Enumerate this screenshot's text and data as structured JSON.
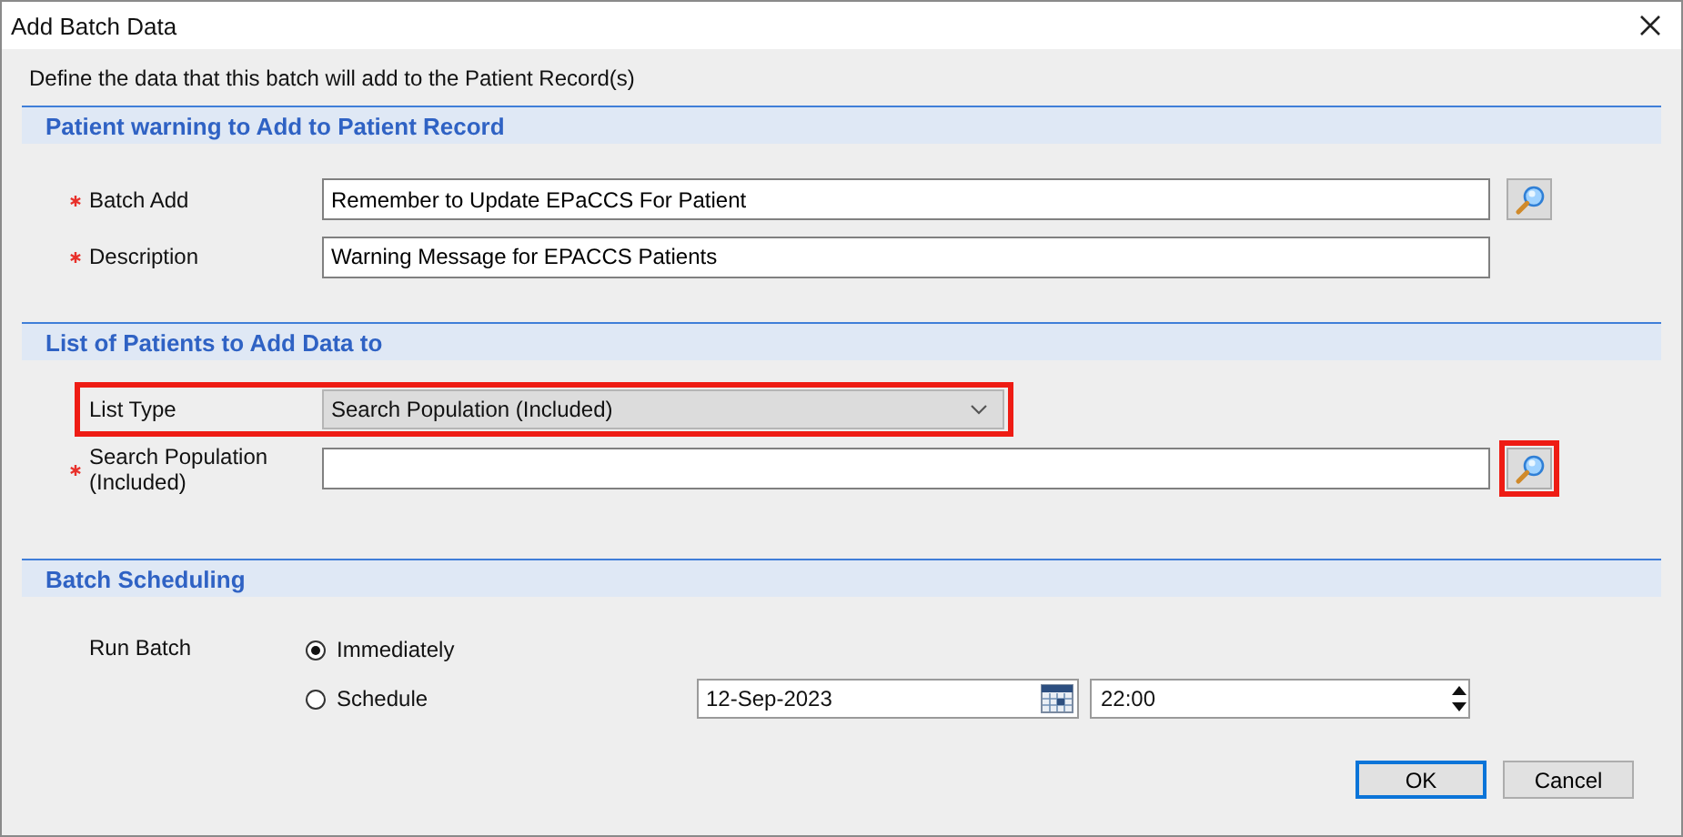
{
  "window": {
    "title": "Add Batch Data"
  },
  "intro": "Define the data that this batch will add to the Patient Record(s)",
  "sections": [
    {
      "title": "Patient warning to Add to Patient Record",
      "rows": [
        {
          "kind": "text",
          "label": "Batch Add",
          "required": true,
          "value": "Remember to Update EPaCCS For Patient",
          "lookup": {
            "highlighted": false
          }
        },
        {
          "kind": "text",
          "label": "Description",
          "required": true,
          "value": "Warning Message for EPACCS Patients"
        }
      ]
    },
    {
      "title": "List of Patients to Add Data to",
      "rows": [
        {
          "kind": "select",
          "label": "List Type",
          "required": false,
          "value": "Search Population (Included)",
          "highlighted": true
        },
        {
          "kind": "text",
          "label": "Search Population (Included)",
          "required": true,
          "lookup": {
            "highlighted": true
          }
        }
      ]
    },
    {
      "title": "Batch Scheduling",
      "rows": [
        {
          "kind": "radio",
          "label": "Run Batch",
          "options": [
            {
              "label": "Immediately",
              "selected": true
            },
            {
              "label": "Schedule",
              "selected": false,
              "date": "12-Sep-2023",
              "time": "22:00"
            }
          ]
        }
      ]
    }
  ],
  "buttons": [
    {
      "label": "OK",
      "default": true
    },
    {
      "label": "Cancel",
      "default": false
    }
  ]
}
